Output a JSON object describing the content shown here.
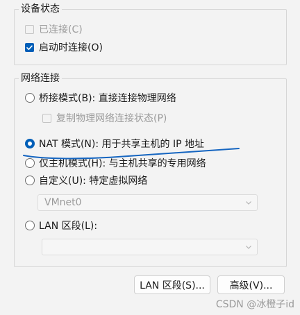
{
  "device_status": {
    "legend": "设备状态",
    "connected": {
      "label": "已连接(C)",
      "checked": false,
      "disabled": true
    },
    "connect_at_power_on": {
      "label": "启动时连接(O)",
      "checked": true,
      "disabled": false
    }
  },
  "network_connection": {
    "legend": "网络连接",
    "bridged": {
      "label": "桥接模式(B): 直接连接物理网络",
      "selected": false
    },
    "replicate_state": {
      "label": "复制物理网络连接状态(P)",
      "checked": false,
      "disabled": true
    },
    "nat": {
      "label": "NAT 模式(N): 用于共享主机的 IP 地址",
      "selected": true
    },
    "host_only": {
      "label": "仅主机模式(H): 与主机共享的专用网络",
      "selected": false
    },
    "custom": {
      "label": "自定义(U): 特定虚拟网络",
      "selected": false
    },
    "custom_select": {
      "value": "VMnet0",
      "disabled": true
    },
    "lan_segment": {
      "label": "LAN 区段(L):",
      "selected": false
    },
    "lan_select": {
      "value": "",
      "disabled": true
    }
  },
  "buttons": {
    "lan_segments": "LAN 区段(S)...",
    "advanced": "高级(V)..."
  },
  "watermark": "CSDN @冰橙子id",
  "colors": {
    "accent": "#005fb8",
    "annotation_ink": "#1565c0",
    "background": "#f3f3f3"
  },
  "icons": {
    "checkmark": "checkmark-icon",
    "dropdown": "chevron-down-icon"
  }
}
